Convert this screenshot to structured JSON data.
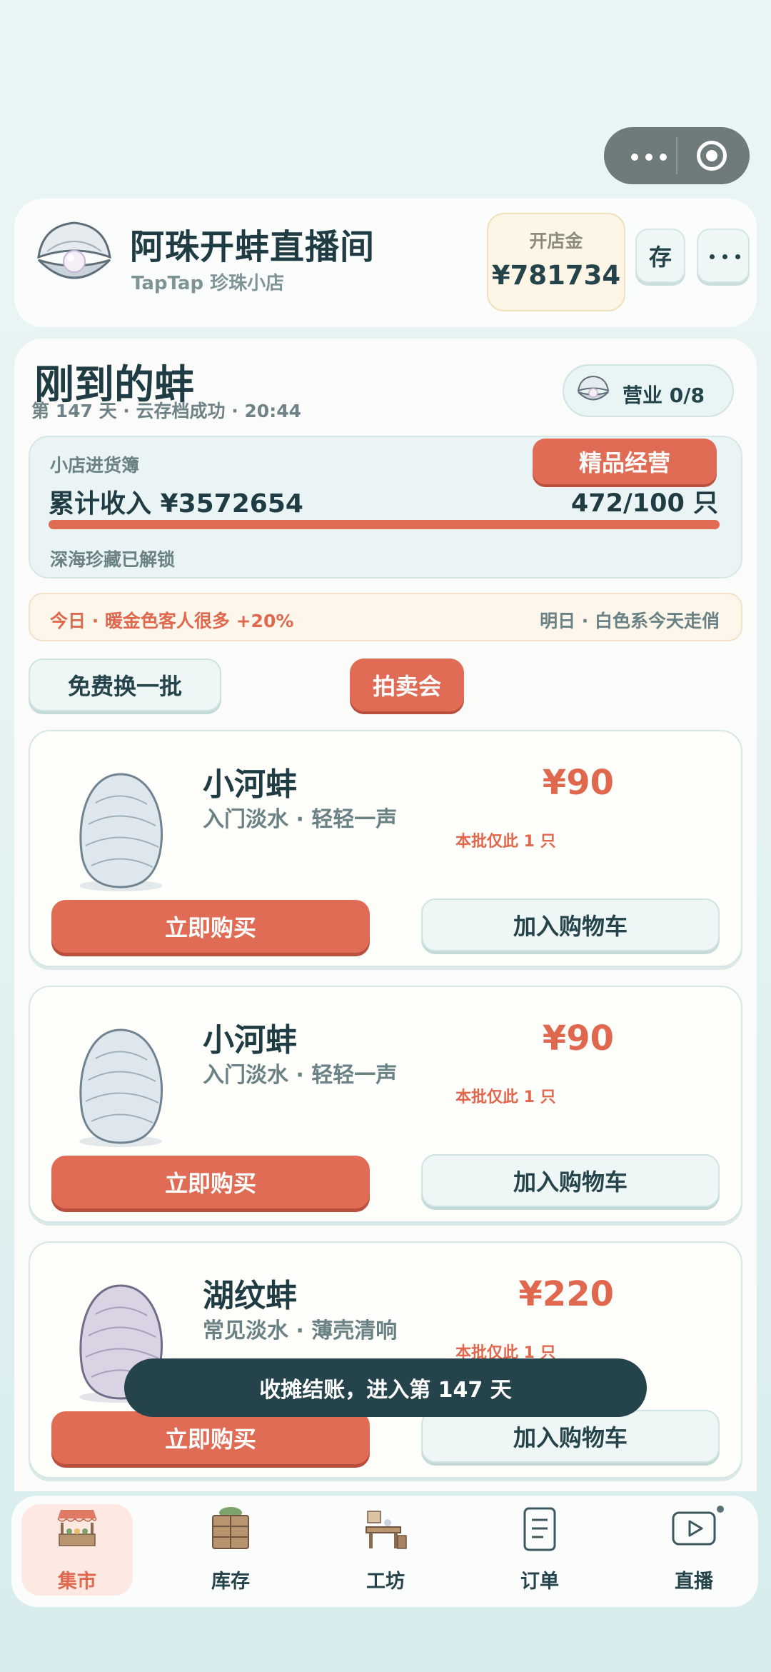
{
  "header": {
    "title": "阿珠开蚌直播间",
    "subtitle": "TapTap 珍珠小店",
    "fund_label": "开店金",
    "fund_value": "¥781734",
    "save_label": "存"
  },
  "market": {
    "title": "刚到的蚌",
    "day_line": "第 147 天 · 云存档成功 · 20:44",
    "business": "营业 0/8"
  },
  "ledger": {
    "label": "小店进货簿",
    "premium_button": "精品经营",
    "income": "累计收入 ¥3572654",
    "count": "472/100 只",
    "progress": 1.0,
    "unlock": "深海珍藏已解锁"
  },
  "news": {
    "today": "今日 · 暖金色客人很多 +20%",
    "tomorrow": "明日 · 白色系今天走俏"
  },
  "actions": {
    "refresh": "免费换一批",
    "auction": "拍卖会"
  },
  "products": [
    {
      "name": "小河蚌",
      "desc": "入门淡水 · 轻轻一声",
      "price": "¥90",
      "stock": "本批仅此 1 只",
      "buy": "立即购买",
      "cart": "加入购物车",
      "color": "#dfe7ee"
    },
    {
      "name": "小河蚌",
      "desc": "入门淡水 · 轻轻一声",
      "price": "¥90",
      "stock": "本批仅此 1 只",
      "buy": "立即购买",
      "cart": "加入购物车",
      "color": "#dfe7ee"
    },
    {
      "name": "湖纹蚌",
      "desc": "常见淡水 · 薄壳清响",
      "price": "¥220",
      "stock": "本批仅此 1 只",
      "buy": "立即购买",
      "cart": "加入购物车",
      "color": "#d9d3e4"
    }
  ],
  "toast": "收摊结账，进入第 147 天",
  "nav": [
    {
      "label": "集市",
      "icon": "market-stall-icon",
      "active": true
    },
    {
      "label": "库存",
      "icon": "crate-icon",
      "active": false
    },
    {
      "label": "工坊",
      "icon": "workbench-icon",
      "active": false
    },
    {
      "label": "订单",
      "icon": "document-icon",
      "active": false
    },
    {
      "label": "直播",
      "icon": "play-icon",
      "active": false
    }
  ],
  "colors": {
    "accent": "#e06c55",
    "dark": "#25434b",
    "muted": "#6a8286"
  }
}
